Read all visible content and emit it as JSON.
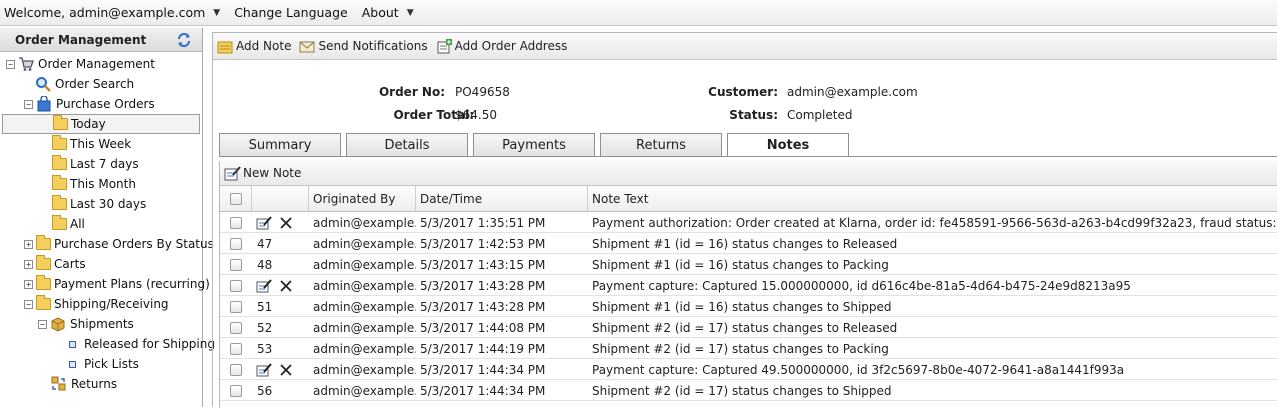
{
  "topbar": {
    "welcome": "Welcome, admin@example.com",
    "change_language": "Change Language",
    "about": "About"
  },
  "left": {
    "header": "Order Management",
    "tree": {
      "root": "Order Management",
      "order_search": "Order Search",
      "purchase_orders": "Purchase Orders",
      "today": "Today",
      "this_week": "This Week",
      "last_7_days": "Last 7 days",
      "this_month": "This Month",
      "last_30_days": "Last 30 days",
      "all": "All",
      "po_by_status": "Purchase Orders By Status",
      "carts": "Carts",
      "payment_plans": "Payment Plans (recurring)",
      "shipping_receiving": "Shipping/Receiving",
      "shipments": "Shipments",
      "released_for_shipping": "Released for Shipping",
      "pick_lists": "Pick Lists",
      "returns": "Returns"
    }
  },
  "toolbar": {
    "add_note": "Add Note",
    "send_notifications": "Send Notifications",
    "add_order_address": "Add Order Address"
  },
  "order": {
    "order_no_label": "Order No:",
    "order_no": "PO49658",
    "order_total_label": "Order Total:",
    "order_total": "$64.50",
    "customer_label": "Customer:",
    "customer": "admin@example.com",
    "status_label": "Status:",
    "status": "Completed"
  },
  "tabs": [
    "Summary",
    "Details",
    "Payments",
    "Returns",
    "Notes"
  ],
  "active_tab": "Notes",
  "notes": {
    "new_note": "New Note",
    "columns": {
      "originated_by": "Originated By",
      "date_time": "Date/Time",
      "note_text": "Note Text"
    },
    "rows": [
      {
        "id": "",
        "editable": true,
        "by": "admin@example...",
        "date": "5/3/2017 1:35:51 PM",
        "text": "Payment authorization: Order created at Klarna, order id: fe458591-9566-563d-a263-b4cd99f32a23, fraud status: ACCEPTED"
      },
      {
        "id": "47",
        "editable": false,
        "by": "admin@example...",
        "date": "5/3/2017 1:42:53 PM",
        "text": "Shipment #1 (id = 16) status changes to Released"
      },
      {
        "id": "48",
        "editable": false,
        "by": "admin@example...",
        "date": "5/3/2017 1:43:15 PM",
        "text": "Shipment #1 (id = 16) status changes to Packing"
      },
      {
        "id": "",
        "editable": true,
        "by": "admin@example...",
        "date": "5/3/2017 1:43:28 PM",
        "text": "Payment capture: Captured 15.000000000, id d616c4be-81a5-4d64-b475-24e9d8213a95"
      },
      {
        "id": "51",
        "editable": false,
        "by": "admin@example...",
        "date": "5/3/2017 1:43:28 PM",
        "text": "Shipment #1 (id = 16) status changes to Shipped"
      },
      {
        "id": "52",
        "editable": false,
        "by": "admin@example...",
        "date": "5/3/2017 1:44:08 PM",
        "text": "Shipment #2 (id = 17) status changes to Released"
      },
      {
        "id": "53",
        "editable": false,
        "by": "admin@example...",
        "date": "5/3/2017 1:44:19 PM",
        "text": "Shipment #2 (id = 17) status changes to Packing"
      },
      {
        "id": "",
        "editable": true,
        "by": "admin@example...",
        "date": "5/3/2017 1:44:34 PM",
        "text": "Payment capture: Captured 49.500000000, id 3f2c5697-8b0e-4072-9641-a8a1441f993a"
      },
      {
        "id": "56",
        "editable": false,
        "by": "admin@example...",
        "date": "5/3/2017 1:44:34 PM",
        "text": "Shipment #2 (id = 17) status changes to Shipped"
      }
    ]
  }
}
